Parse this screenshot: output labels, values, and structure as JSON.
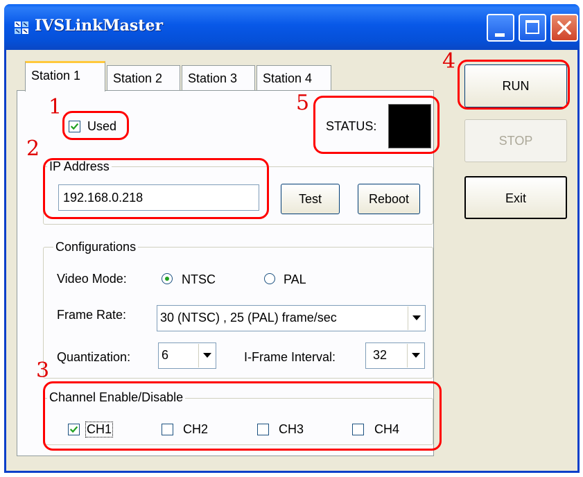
{
  "window": {
    "title": "IVSLinkMaster",
    "buttons": {
      "minimize": "minimize",
      "maximize": "maximize",
      "close": "close"
    }
  },
  "tabs": [
    {
      "label": "Station 1",
      "active": true
    },
    {
      "label": "Station 2",
      "active": false
    },
    {
      "label": "Station 3",
      "active": false
    },
    {
      "label": "Station 4",
      "active": false
    }
  ],
  "station": {
    "used_label": "Used",
    "used_checked": true,
    "status_label": "STATUS:",
    "ip_group_title": "IP Address",
    "ip_value": "192.168.0.218",
    "test_label": "Test",
    "reboot_label": "Reboot",
    "config_group_title": "Configurations",
    "video_mode_label": "Video Mode:",
    "video_mode_options": [
      "NTSC",
      "PAL"
    ],
    "video_mode_selected": "NTSC",
    "frame_rate_label": "Frame Rate:",
    "frame_rate_value": "30 (NTSC) , 25 (PAL) frame/sec",
    "quantization_label": "Quantization:",
    "quantization_value": "6",
    "iframe_label": "I-Frame Interval:",
    "iframe_value": "32",
    "channel_group_title": "Channel Enable/Disable",
    "channels": [
      {
        "label": "CH1",
        "checked": true
      },
      {
        "label": "CH2",
        "checked": false
      },
      {
        "label": "CH3",
        "checked": false
      },
      {
        "label": "CH4",
        "checked": false
      }
    ]
  },
  "side_buttons": {
    "run": "RUN",
    "stop": "STOP",
    "exit": "Exit"
  },
  "annotations": [
    "1",
    "2",
    "3",
    "4",
    "5"
  ],
  "colors": {
    "annotation": "#ff0000",
    "titlebar": "#0858e8",
    "status_indicator": "#000000"
  }
}
